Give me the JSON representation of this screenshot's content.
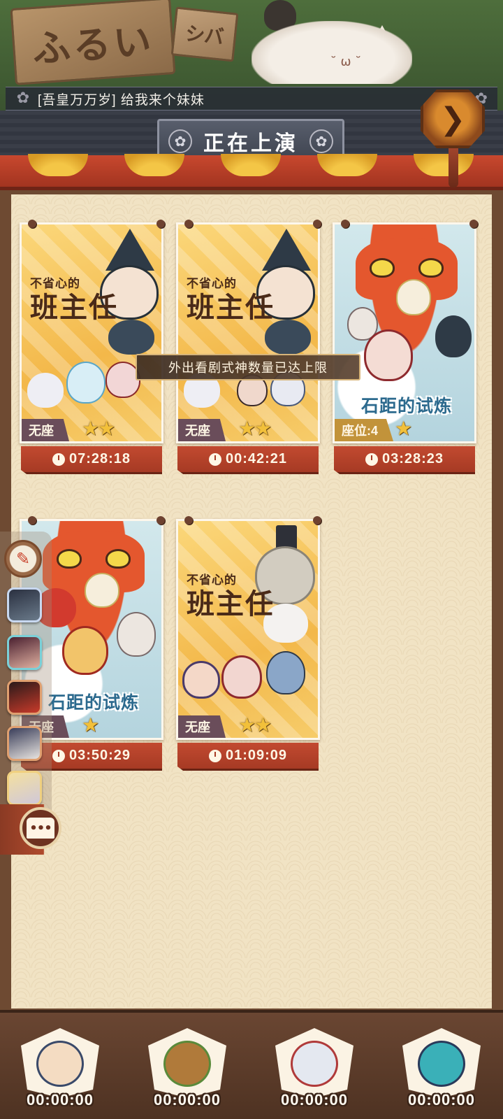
{
  "header": {
    "sign_text": "ふるい",
    "sign_small_text": "シバ",
    "ticker_message": "[吾皇万万岁] 给我来个妹妹",
    "title": "正在上演",
    "next_icon": "chevron-right-icon",
    "flower_icon": "sakura-crest-icon"
  },
  "toast": "外出看剧式神数量已达上限",
  "cards": [
    {
      "title_small": "不省心的",
      "title_big": "班主任",
      "seat": "无座",
      "stars": "★★",
      "timer": "07:28:18"
    },
    {
      "title_small": "不省心的",
      "title_big": "班主任",
      "seat": "无座",
      "stars": "★★",
      "timer": "00:42:21"
    },
    {
      "title": "石距的试炼",
      "seat": "座位:4",
      "stars": "★",
      "timer": "03:28:23"
    },
    {
      "title": "石距的试炼",
      "seat": "无座",
      "stars": "★",
      "timer": "03:50:29"
    },
    {
      "title_small": "不省心的",
      "title_big": "班主任",
      "seat": "无座",
      "stars": "★★",
      "timer": "01:09:09"
    }
  ],
  "side_dock": {
    "top_icon": "notice-board-icon",
    "home_label": "•••"
  },
  "slots": [
    {
      "timer": "00:00:00"
    },
    {
      "timer": "00:00:00"
    },
    {
      "timer": "00:00:00"
    },
    {
      "timer": "00:00:00"
    }
  ],
  "colors": {
    "accent_red": "#c24a30",
    "board": "#f1e3c4",
    "seat_tag": "#6a4d5a",
    "star": "#f2c03a"
  }
}
